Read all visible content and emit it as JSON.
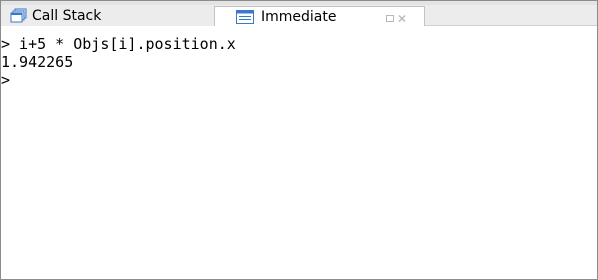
{
  "tabs": [
    {
      "label": "Call Stack",
      "icon": "stack-icon",
      "active": false
    },
    {
      "label": "Immediate",
      "icon": "window-icon",
      "active": true
    }
  ],
  "console": {
    "lines": [
      "> i+5 * Objs[i].position.x",
      "1.942265",
      ">"
    ]
  },
  "colors": {
    "icon_blue": "#3a78c9",
    "tab_active_bg": "#ffffff",
    "tab_inactive_bg": "#ececec"
  }
}
